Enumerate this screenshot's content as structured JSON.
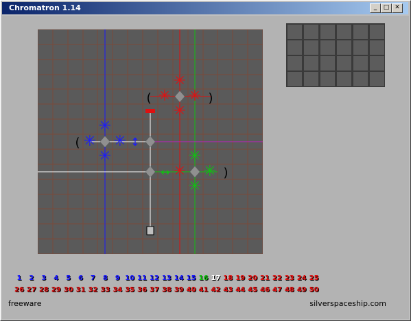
{
  "window": {
    "title": "Chromatron 1.14"
  },
  "titlebar_buttons": {
    "minimize": "_",
    "maximize": "□",
    "close": "✕"
  },
  "colors": {
    "blue": "#1a1aff",
    "red": "#e01010",
    "green": "#10c010",
    "white": "#ffffff",
    "magenta": "#c020c0",
    "board": "#5a5a5a",
    "grid": "#7a4a3a"
  },
  "levels_row1": [
    "1",
    "2",
    "3",
    "4",
    "5",
    "6",
    "7",
    "8",
    "9",
    "10",
    "11",
    "12",
    "13",
    "14",
    "15",
    "16",
    "17",
    "18",
    "19",
    "20",
    "21",
    "22",
    "23",
    "24",
    "25"
  ],
  "levels_row2": [
    "26",
    "27",
    "28",
    "29",
    "30",
    "31",
    "32",
    "33",
    "34",
    "35",
    "36",
    "37",
    "38",
    "39",
    "40",
    "41",
    "42",
    "43",
    "44",
    "45",
    "46",
    "47",
    "48",
    "49",
    "50"
  ],
  "footer": {
    "left": "freeware",
    "right": "silverspaceship.com"
  }
}
